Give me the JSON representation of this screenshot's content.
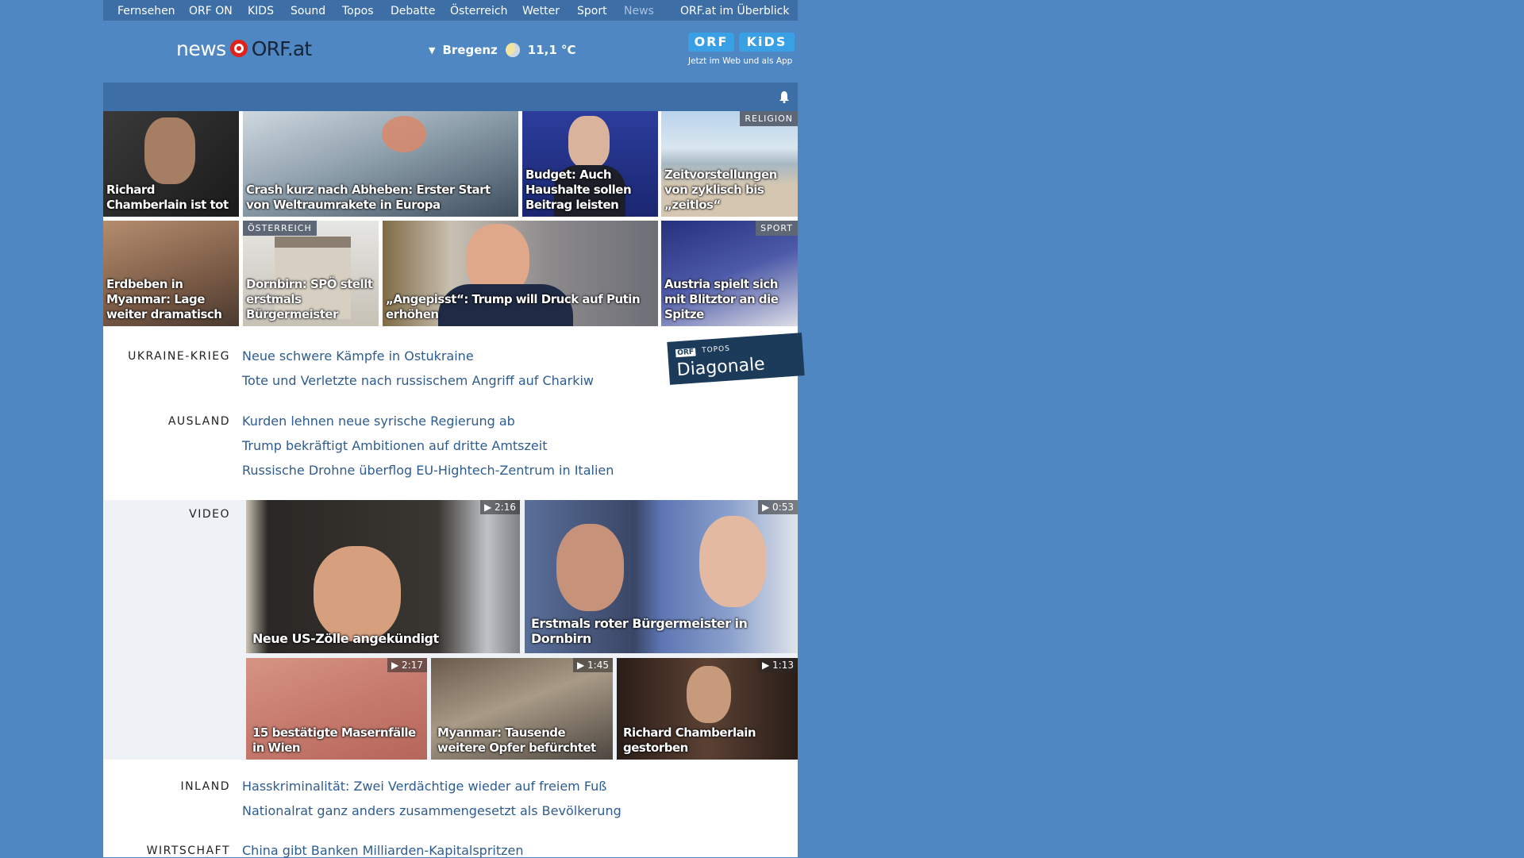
{
  "topnav": [
    "Fernsehen",
    "ORF ON",
    "KIDS",
    "Sound",
    "Topos",
    "Debatte",
    "Österreich",
    "Wetter",
    "Sport",
    "News",
    "ORF.at im Überblick"
  ],
  "header": {
    "logo_news": "news",
    "logo_orfat": "ORF.at",
    "city": "Bregenz",
    "temperature": "11,1 °C",
    "kids_orf": "ORF",
    "kids_kids": "KiDS",
    "kids_tagline": "Jetzt im Web und als App"
  },
  "colors": {
    "background": "#4f87c3",
    "nav": "#3d6fa6",
    "link": "#2f5c8f",
    "orf_red": "#e1221b"
  },
  "top_tiles": [
    {
      "caption": "Richard Chamberlain ist tot"
    },
    {
      "caption": "Crash kurz nach Abheben: Erster Start von Weltraumrakete in Europa"
    },
    {
      "caption": "Budget: Auch Haushalte sollen Beitrag leisten"
    },
    {
      "caption": "Zeitvorstellungen von zyklisch bis „zeitlos“",
      "label": "RELIGION"
    },
    {
      "caption": "Erdbeben in Myanmar: Lage weiter dramatisch"
    },
    {
      "caption": "Dornbirn: SPÖ stellt erstmals Bürgermeister",
      "label": "ÖSTERREICH"
    },
    {
      "caption": "„Angepisst“: Trump will Druck auf Putin erhöhen"
    },
    {
      "caption": "Austria spielt sich mit Blitztor an die Spitze",
      "label": "SPORT"
    }
  ],
  "sections": [
    {
      "title": "UKRAINE-KRIEG",
      "links": [
        "Neue schwere Kämpfe in Ostukraine",
        "Tote und Verletzte nach russischem Angriff auf Charkiw"
      ]
    },
    {
      "title": "AUSLAND",
      "links": [
        "Kurden lehnen neue syrische Regierung ab",
        "Trump bekräftigt Ambitionen auf dritte Amtszeit",
        "Russische Drohne überflog EU-Hightech-Zentrum in Italien"
      ]
    }
  ],
  "promo": {
    "orf": "ORF",
    "topos": "TOPOS",
    "name": "Diagonale"
  },
  "video": {
    "title": "VIDEO",
    "items": [
      {
        "caption": "Neue US-Zölle angekündigt",
        "duration": "▶ 2:16"
      },
      {
        "caption": "Erstmals roter Bürgermeister in Dornbirn",
        "duration": "▶ 0:53"
      },
      {
        "caption": "15 bestätigte Masernfälle in Wien",
        "duration": "▶ 2:17"
      },
      {
        "caption": "Myanmar: Tausende weitere Opfer befürchtet",
        "duration": "▶ 1:45"
      },
      {
        "caption": "Richard Chamberlain gestorben",
        "duration": "▶ 1:13"
      }
    ]
  },
  "sections2": [
    {
      "title": "INLAND",
      "links": [
        "Hasskriminalität: Zwei Verdächtige wieder auf freiem Fuß",
        "Nationalrat ganz anders zusammengesetzt als Bevölkerung"
      ]
    },
    {
      "title": "WIRTSCHAFT",
      "links": [
        "China gibt Banken Milliarden-Kapitalspritzen"
      ]
    }
  ]
}
